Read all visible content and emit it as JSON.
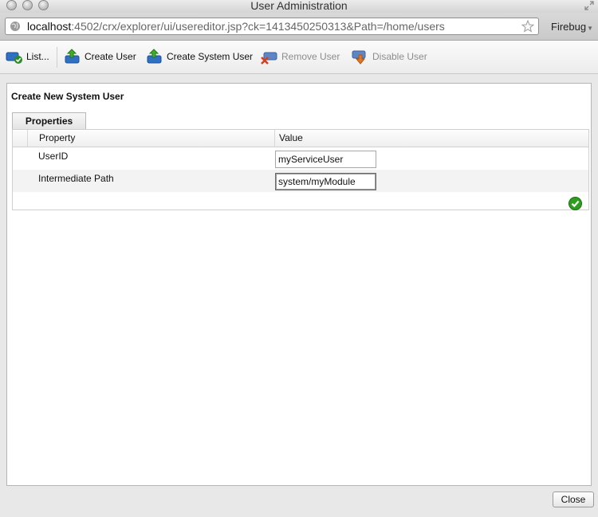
{
  "window": {
    "title": "User Administration"
  },
  "address_bar": {
    "host": "localhost",
    "path": ":4502/crx/explorer/ui/usereditor.jsp?ck=1413450250313&Path=/home/users",
    "extension_label": "Firebug"
  },
  "toolbar": {
    "list_label": "List...",
    "create_user_label": "Create User",
    "create_system_user_label": "Create System User",
    "remove_user_label": "Remove User",
    "disable_user_label": "Disable User"
  },
  "panel": {
    "title": "Create New System User",
    "tab_label": "Properties",
    "columns": {
      "property": "Property",
      "value": "Value"
    },
    "rows": [
      {
        "property": "UserID",
        "value": "myServiceUser"
      },
      {
        "property": "Intermediate Path",
        "value": "system/myModule"
      }
    ]
  },
  "footer": {
    "close_label": "Close"
  },
  "icons": {
    "window_buttons": "traffic-light-buttons",
    "address_icon": "globe-icon",
    "bookmark_icon": "star-icon",
    "list_icon": "user-list-icon",
    "create_icon": "user-add-icon",
    "remove_icon": "user-remove-icon",
    "disable_icon": "user-disable-icon",
    "confirm_icon": "check-icon"
  },
  "colors": {
    "confirm_green": "#2e9e1e",
    "add_green": "#3fae2a",
    "user_blue": "#2f6fc4",
    "remove_red": "#d44020",
    "disable_orange": "#e0782a"
  }
}
